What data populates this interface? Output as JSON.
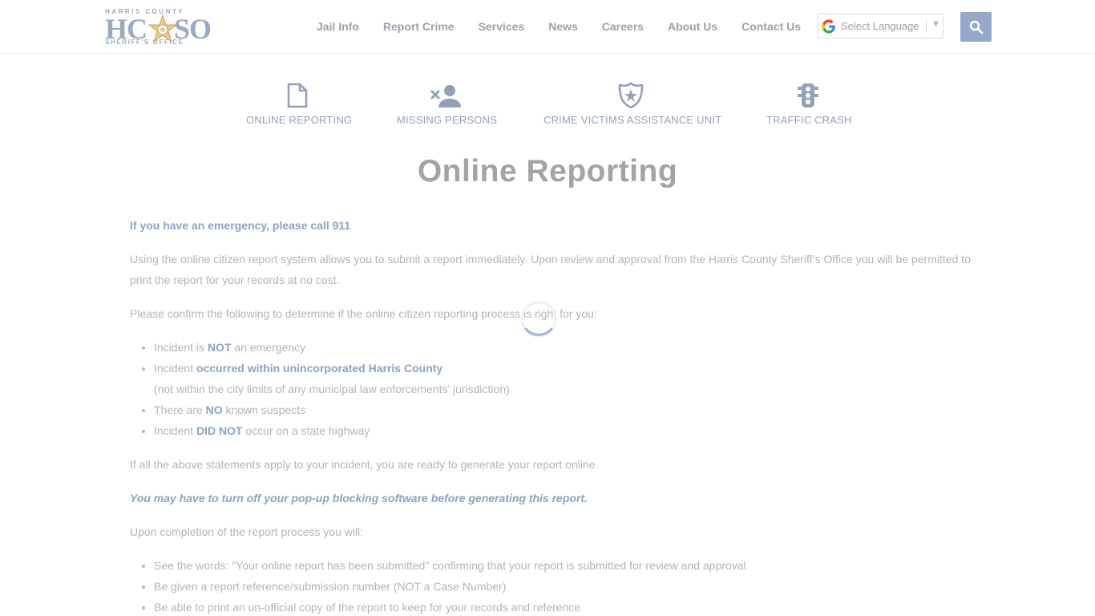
{
  "header": {
    "logo": {
      "top_text": "HARRIS COUNTY",
      "big_text_left": "HC",
      "big_text_right": "SO",
      "bottom_text": "SHERIFF'S OFFICE"
    },
    "nav": [
      "Jail Info",
      "Report Crime",
      "Services",
      "News",
      "Careers",
      "About Us",
      "Contact Us"
    ],
    "language": {
      "label": "Select Language",
      "arrow": "▼"
    }
  },
  "quick_links": [
    {
      "label": "ONLINE REPORTING",
      "icon": "document-icon"
    },
    {
      "label": "MISSING PERSONS",
      "icon": "person-remove-icon"
    },
    {
      "label": "CRIME VICTIMS ASSISTANCE UNIT",
      "icon": "badge-icon"
    },
    {
      "label": "TRAFFIC CRASH",
      "icon": "traffic-light-icon"
    }
  ],
  "page_title": "Online Reporting",
  "content": {
    "emergency": "If you have an emergency, please call 911",
    "intro": "Using the online citizen report system allows you to submit a report immediately. Upon review and approval from the Harris County Sheriff’s Office you will be permitted to print the report for your records at no cost.",
    "confirm": "Please confirm the following to determine if the online citizen reporting process is right for you:",
    "criteria": {
      "c1_a": "Incident is ",
      "c1_b": "NOT",
      "c1_c": " an emergency",
      "c2_a": "Incident ",
      "c2_b": "occurred within unincorporated Harris County",
      "c2_note": "(not within the city limits of any municipal law enforcements’ jurisdiction)",
      "c3_a": "There are ",
      "c3_b": "NO",
      "c3_c": " known suspects",
      "c4_a": "Incident ",
      "c4_b": "DID NOT",
      "c4_c": " occur on a state highway"
    },
    "ready": "If all the above statements apply to your incident, you are ready to generate your report online.",
    "popup": "You may have to turn off your pop-up blocking software before generating this report.",
    "completion": "Upon completion of the report process you will:",
    "completion_items": [
      "See the words: \"Your online report has been submitted\" confirming that your report is submitted for review and approval",
      "Be given a report reference/submission number (NOT a Case Number)",
      "Be able to print an un-official copy of the report to keep for your records and reference"
    ]
  },
  "colors": {
    "accent": "#8da2c2",
    "search_button": "#96a8c8",
    "text": "#b4b4b4"
  }
}
